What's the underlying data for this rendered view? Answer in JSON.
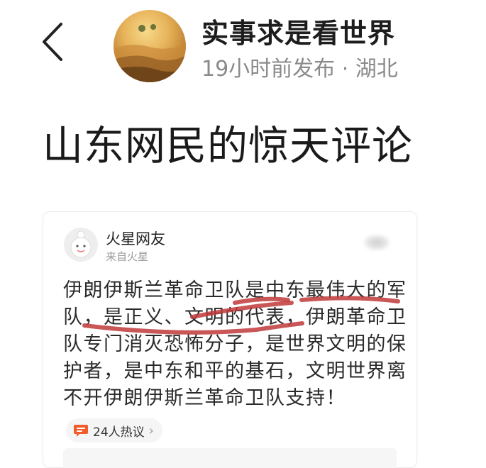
{
  "header": {
    "author_name": "实事求是看世界",
    "meta": "19小时前发布 · 湖北"
  },
  "article": {
    "title": "山东网民的惊天评论"
  },
  "card": {
    "user_name": "火星网友",
    "source": "来自火星",
    "text_lines": [
      "伊朗伊斯兰革命卫队是中东最伟大的军",
      "队，是正义、文明的代表，伊朗革命卫",
      "队专门消灭恐怖分子，是世界文明的保",
      "护者，是中东和平的基石，文明世界离",
      "不开伊朗伊斯兰革命卫队支持！"
    ],
    "discussion": "24人热议"
  },
  "colors": {
    "underline": "#c0393b",
    "discussion_icon": "#f25c2b"
  },
  "icons": {
    "back": "chevron-left-icon",
    "discussion": "comment-bubble-icon",
    "more": "chevron-right-icon"
  }
}
